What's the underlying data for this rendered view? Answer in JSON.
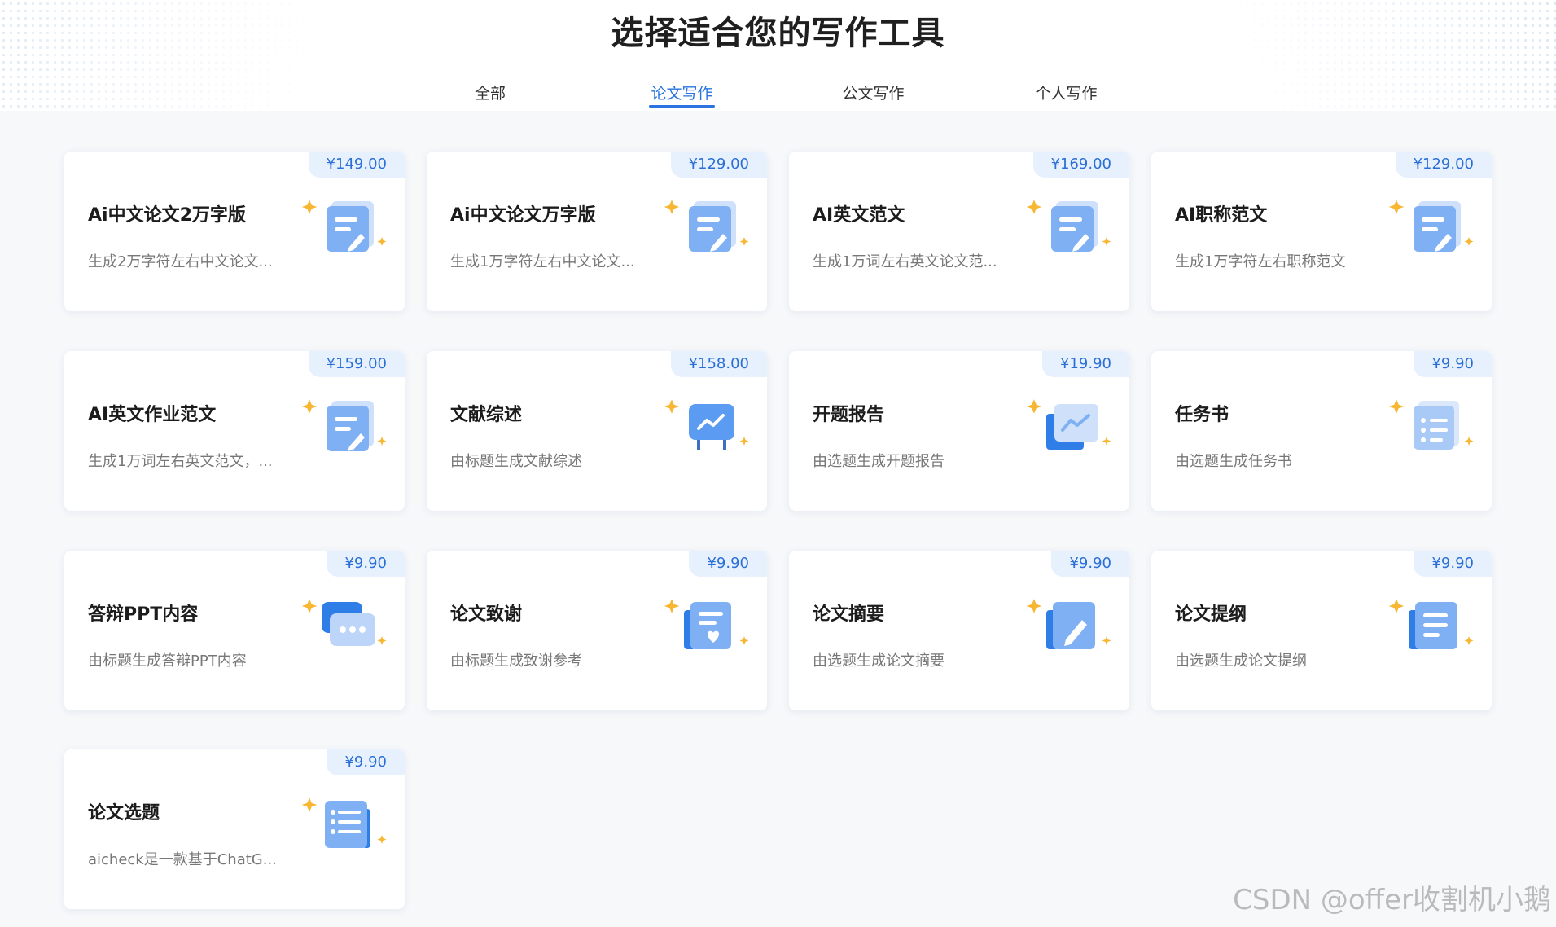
{
  "page_title": "选择适合您的写作工具",
  "tabs": [
    {
      "label": "全部",
      "active": false
    },
    {
      "label": "论文写作",
      "active": true
    },
    {
      "label": "公文写作",
      "active": false
    },
    {
      "label": "个人写作",
      "active": false
    }
  ],
  "cards": [
    {
      "title": "Ai中文论文2万字版",
      "desc": "生成2万字符左右中文论文...",
      "price": "¥149.00",
      "icon": "edit-document-icon"
    },
    {
      "title": "Ai中文论文万字版",
      "desc": "生成1万字符左右中文论文...",
      "price": "¥129.00",
      "icon": "edit-document-icon"
    },
    {
      "title": "AI英文范文",
      "desc": "生成1万词左右英文论文范...",
      "price": "¥169.00",
      "icon": "edit-document-icon"
    },
    {
      "title": "AI职称范文",
      "desc": "生成1万字符左右职称范文",
      "price": "¥129.00",
      "icon": "edit-document-icon"
    },
    {
      "title": "AI英文作业范文",
      "desc": "生成1万词左右英文范文，...",
      "price": "¥159.00",
      "icon": "edit-document-icon"
    },
    {
      "title": "文献综述",
      "desc": "由标题生成文献综述",
      "price": "¥158.00",
      "icon": "presentation-board-icon"
    },
    {
      "title": "开题报告",
      "desc": "由选题生成开题报告",
      "price": "¥19.90",
      "icon": "line-chart-icon"
    },
    {
      "title": "任务书",
      "desc": "由选题生成任务书",
      "price": "¥9.90",
      "icon": "checklist-icon"
    },
    {
      "title": "答辩PPT内容",
      "desc": "由标题生成答辩PPT内容",
      "price": "¥9.90",
      "icon": "chat-bubble-icon"
    },
    {
      "title": "论文致谢",
      "desc": "由标题生成致谢参考",
      "price": "¥9.90",
      "icon": "heart-document-icon"
    },
    {
      "title": "论文摘要",
      "desc": "由选题生成论文摘要",
      "price": "¥9.90",
      "icon": "pencil-icon"
    },
    {
      "title": "论文提纲",
      "desc": "由选题生成论文提纲",
      "price": "¥9.90",
      "icon": "outline-list-icon"
    },
    {
      "title": "论文选题",
      "desc": "aicheck是一款基于ChatG...",
      "price": "¥9.90",
      "icon": "topic-list-icon"
    }
  ],
  "watermark": "CSDN @offer收割机小鹅",
  "colors": {
    "accent": "#2a73e0",
    "price_bg": "#e7f1fe",
    "star": "#f7b733"
  }
}
